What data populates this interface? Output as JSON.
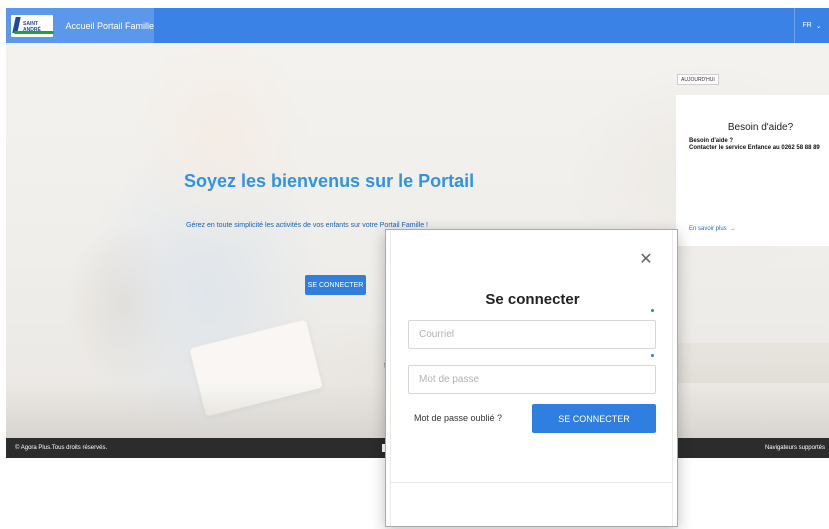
{
  "header": {
    "logo_text": "SAINT ANDRÉ",
    "title": "Accueil Portail Famille",
    "language": "FR",
    "language_chevron": "⌄"
  },
  "hero": {
    "title": "Soyez les bienvenus sur le Portail",
    "subtitle": "Gérez en toute simplicité les activités de vos enfants sur votre Portail Famille !",
    "login_button": "SE CONNECTER",
    "side_mark": "t"
  },
  "today": {
    "badge": "AUJOURD'HUI"
  },
  "help": {
    "title": "Besoin d'aide?",
    "body_line1": "Besoin d'aide ?",
    "body_line2": "Contacter le service Enfance au 0262 58 88 89",
    "more_label": "En savoir plus",
    "more_arrow": "→"
  },
  "footer": {
    "copyright": "© Agora Plus.Tous droits réservés.",
    "browsers_link": "Navigateurs supportés"
  },
  "login_modal": {
    "close_symbol": "✕",
    "title": "Se connecter",
    "email_placeholder": "Courriel",
    "password_placeholder": "Mot de passe",
    "forgot_password": "Mot de passe oublié ?",
    "submit_label": "SE CONNECTER"
  },
  "colors": {
    "primary": "#3b82e6",
    "button": "#2f7fe0",
    "footer": "#2c2c2c",
    "title_blue": "#2f93e8"
  }
}
